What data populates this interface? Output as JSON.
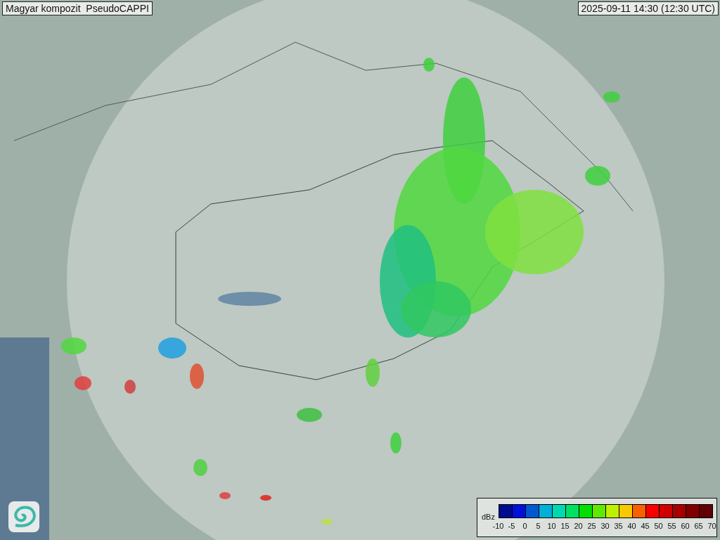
{
  "title": "Magyar kompozit  PseudoCAPPI",
  "timestamp": "2025-09-11 14:30 (12:30 UTC)",
  "legend": {
    "unit": "dBz",
    "colors": [
      {
        "color": "#000c8f"
      },
      {
        "color": "#0010d8"
      },
      {
        "color": "#0058d0"
      },
      {
        "color": "#00b0d8"
      },
      {
        "color": "#00d8b0"
      },
      {
        "color": "#00e060"
      },
      {
        "color": "#00e000"
      },
      {
        "color": "#60e800"
      },
      {
        "color": "#c0f000"
      },
      {
        "color": "#f8c800"
      },
      {
        "color": "#f86000"
      },
      {
        "color": "#f80000"
      },
      {
        "color": "#d00000"
      },
      {
        "color": "#a80000"
      },
      {
        "color": "#800000"
      },
      {
        "color": "#600000"
      }
    ],
    "ticks": [
      "-10",
      "-5",
      "0",
      "5",
      "10",
      "15",
      "20",
      "25",
      "30",
      "35",
      "40",
      "45",
      "50",
      "55",
      "60",
      "65",
      "70"
    ]
  }
}
